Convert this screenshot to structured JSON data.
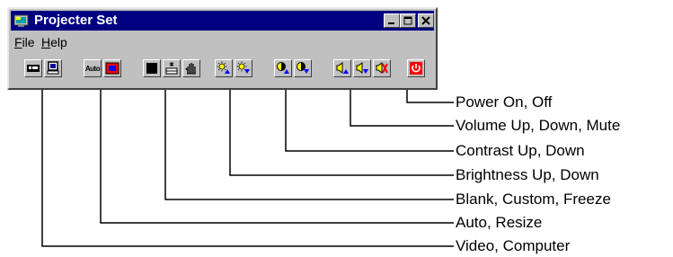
{
  "window": {
    "title": "Projecter Set",
    "controls": [
      "minimize-icon",
      "maximize-icon",
      "close-icon"
    ]
  },
  "menu": {
    "file_first": "F",
    "file_rest": "ile",
    "help_first": "H",
    "help_rest": "elp"
  },
  "toolbar": {
    "icons": [
      [
        "video-icon",
        "computer-icon"
      ],
      [
        "auto-icon",
        "resize-icon"
      ],
      [
        "blank-icon",
        "custom-icon",
        "freeze-icon"
      ],
      [
        "brightness-up-icon",
        "brightness-down-icon"
      ],
      [
        "contrast-up-icon",
        "contrast-down-icon"
      ],
      [
        "volume-up-icon",
        "volume-down-icon",
        "mute-icon"
      ],
      [
        "power-icon"
      ]
    ],
    "auto_text": "Auto",
    "colors": {
      "power": "#ff0000",
      "resize": "#ff0000",
      "arrow": "#0000ff",
      "titlebar": "#000080"
    }
  },
  "callouts": [
    "Power On, Off",
    "Volume Up, Down, Mute",
    "Contrast Up, Down",
    "Brightness Up, Down",
    "Blank, Custom, Freeze",
    "Auto, Resize",
    "Video, Computer"
  ]
}
